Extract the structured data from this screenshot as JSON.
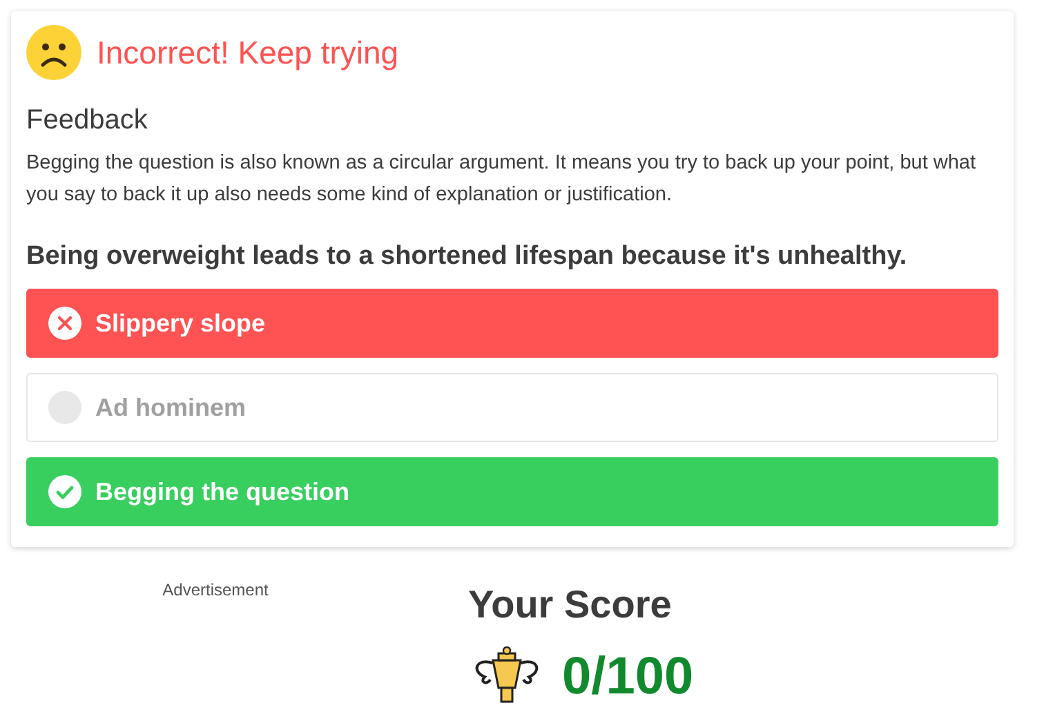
{
  "result": {
    "title": "Incorrect! Keep trying"
  },
  "feedback": {
    "heading": "Feedback",
    "text": "Begging the question is also known as a circular argument. It means you try to back up your point, but what you say to back it up also needs some kind of explanation or justification."
  },
  "question": "Being overweight leads to a shortened lifespan because it's unhealthy.",
  "options": [
    {
      "label": "Slippery slope",
      "kind": "wrong"
    },
    {
      "label": "Ad hominem",
      "kind": "neutral"
    },
    {
      "label": "Begging the question",
      "kind": "correct"
    }
  ],
  "ad_label": "Advertisement",
  "score": {
    "heading": "Your Score",
    "value": "0/100"
  }
}
